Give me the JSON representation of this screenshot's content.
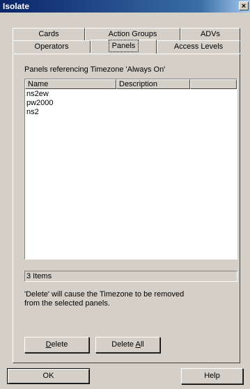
{
  "window": {
    "title": "Isolate",
    "close_glyph": "×"
  },
  "tabs": {
    "row1": [
      {
        "label": "Cards"
      },
      {
        "label": "Action Groups"
      },
      {
        "label": "ADVs"
      }
    ],
    "row2": [
      {
        "label": "Operators"
      },
      {
        "label": "Panels"
      },
      {
        "label": "Access Levels"
      }
    ],
    "active": "Panels"
  },
  "panel": {
    "heading": "Panels referencing Timezone 'Always On'",
    "columns": [
      "Name",
      "Description"
    ],
    "rows": [
      {
        "name": "ns2ew",
        "description": ""
      },
      {
        "name": "pw2000",
        "description": ""
      },
      {
        "name": "ns2",
        "description": ""
      }
    ],
    "status": "3 Items",
    "help_line1": "'Delete' will cause the Timezone to be removed",
    "help_line2": "from the selected panels.",
    "delete_pre": "",
    "delete_mn": "D",
    "delete_post": "elete",
    "delete_all_pre": "Delete ",
    "delete_all_mn": "A",
    "delete_all_post": "ll"
  },
  "buttons": {
    "ok": "OK",
    "help": "Help"
  }
}
